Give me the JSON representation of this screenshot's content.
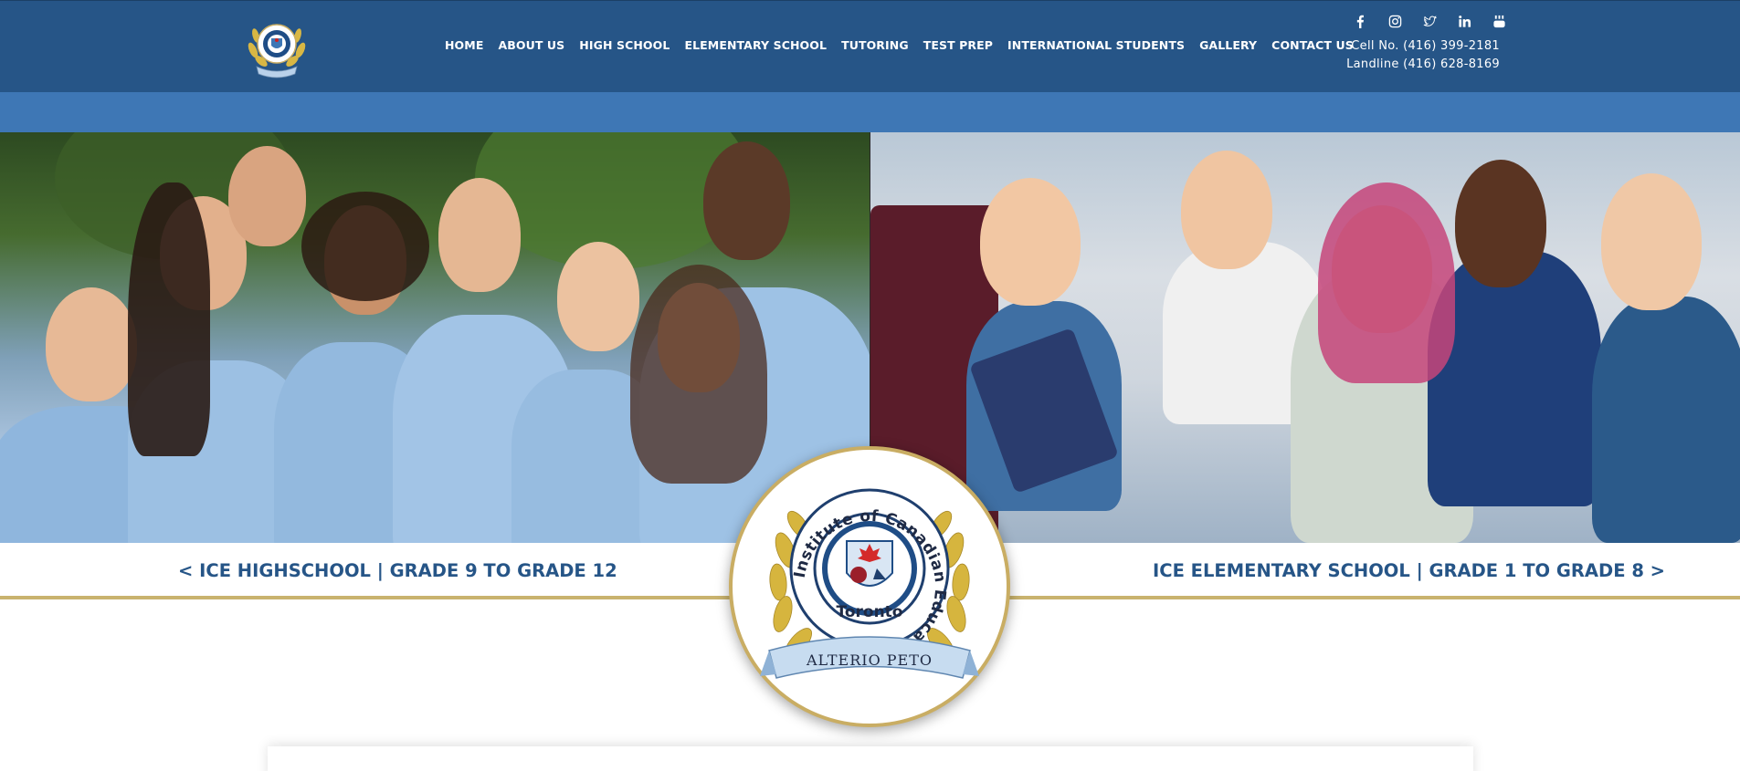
{
  "header": {
    "nav": [
      {
        "label": "HOME"
      },
      {
        "label": "ABOUT US"
      },
      {
        "label": "HIGH SCHOOL"
      },
      {
        "label": "ELEMENTARY SCHOOL"
      },
      {
        "label": "TUTORING"
      },
      {
        "label": "TEST PREP"
      },
      {
        "label": "INTERNATIONAL STUDENTS"
      },
      {
        "label": "GALLERY"
      },
      {
        "label": "CONTACT US"
      }
    ],
    "social_icons": [
      "facebook-icon",
      "instagram-icon",
      "twitter-icon",
      "linkedin-icon",
      "youtube-icon"
    ],
    "cell": "Cell No. (416) 399-2181",
    "landline": "Landline (416) 628-8169"
  },
  "hero": {
    "left_link": "< ICE HIGHSCHOOL | GRADE 9 TO GRADE 12",
    "right_link": "ICE ELEMENTARY SCHOOL | GRADE 1 TO GRADE 8 >"
  },
  "seal": {
    "ring_text": "Institute of Canadian Education",
    "city": "Toronto",
    "motto": "ALTERIO PETO"
  },
  "colors": {
    "header_bg": "#265587",
    "subbar_bg": "#3e77b5",
    "link_text": "#265587",
    "gold_accent": "#c9b36e"
  }
}
